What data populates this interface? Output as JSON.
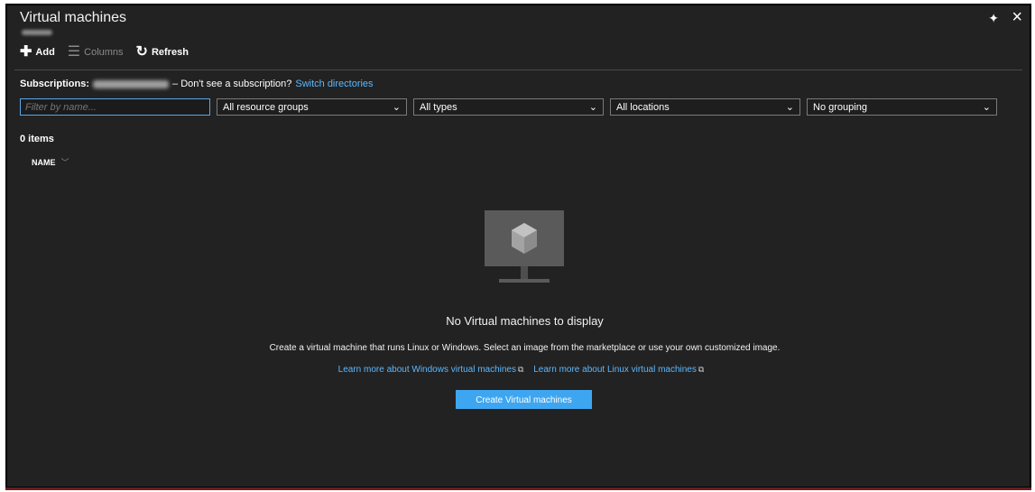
{
  "header": {
    "title": "Virtual machines",
    "pin_icon": "pin-icon",
    "close_icon": "close-icon"
  },
  "toolbar": {
    "add_label": "Add",
    "columns_label": "Columns",
    "refresh_label": "Refresh"
  },
  "subscriptions": {
    "label": "Subscriptions:",
    "prompt": "– Don't see a subscription?",
    "link": "Switch directories"
  },
  "filters": {
    "name_placeholder": "Filter by name...",
    "resource_groups": "All resource groups",
    "types": "All types",
    "locations": "All locations",
    "grouping": "No grouping"
  },
  "list": {
    "count": "0 items",
    "columns": [
      "NAME"
    ]
  },
  "empty_state": {
    "title": "No Virtual machines to display",
    "description": "Create a virtual machine that runs Linux or Windows. Select an image from the marketplace or use your own customized image.",
    "link_windows": "Learn more about Windows virtual machines",
    "link_linux": "Learn more about Linux virtual machines",
    "create_button": "Create Virtual machines"
  },
  "colors": {
    "background": "#222222",
    "accent": "#3ea6f0",
    "link": "#5cb8ff"
  }
}
